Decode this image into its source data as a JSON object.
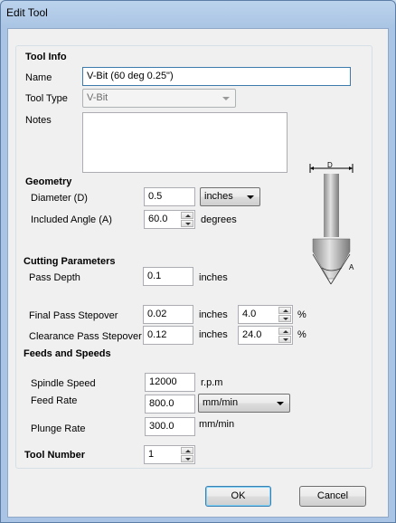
{
  "window": {
    "title": "Edit Tool"
  },
  "tool_info": {
    "header": "Tool Info",
    "name_label": "Name",
    "name_value": "V-Bit (60 deg 0.25\")",
    "tool_type_label": "Tool Type",
    "tool_type_value": "V-Bit",
    "notes_label": "Notes",
    "notes_value": ""
  },
  "diagram": {
    "label_d": "D",
    "label_a": "A"
  },
  "geometry": {
    "header": "Geometry",
    "diameter_label": "Diameter (D)",
    "diameter_value": "0.5",
    "diameter_units": "inches",
    "angle_label": "Included Angle (A)",
    "angle_value": "60.0",
    "angle_units": "degrees"
  },
  "cutting": {
    "header": "Cutting Parameters",
    "pass_depth_label": "Pass Depth",
    "pass_depth_value": "0.1",
    "pass_depth_units": "inches",
    "final_label": "Final Pass Stepover",
    "final_value": "0.02",
    "final_units": "inches",
    "final_pct": "4.0",
    "clear_label": "Clearance Pass Stepover",
    "clear_value": "0.12",
    "clear_units": "inches",
    "clear_pct": "24.0",
    "pct_sign": "%"
  },
  "feeds": {
    "header": "Feeds and Speeds",
    "spindle_label": "Spindle Speed",
    "spindle_value": "12000",
    "spindle_units": "r.p.m",
    "feed_label": "Feed Rate",
    "feed_value": "800.0",
    "feed_units": "mm/min",
    "plunge_label": "Plunge Rate",
    "plunge_value": "300.0",
    "plunge_units": "mm/min"
  },
  "tool_number": {
    "label": "Tool Number",
    "value": "1"
  },
  "buttons": {
    "ok": "OK",
    "cancel": "Cancel"
  }
}
